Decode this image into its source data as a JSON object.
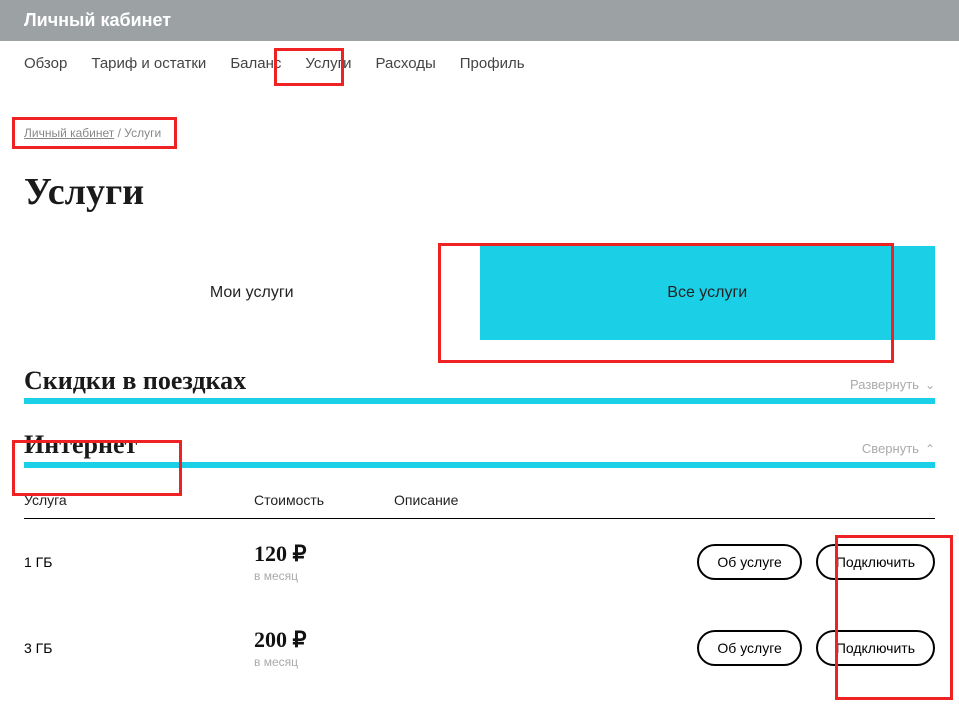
{
  "header": {
    "title": "Личный кабинет"
  },
  "nav": {
    "items": [
      "Обзор",
      "Тариф и остатки",
      "Баланс",
      "Услуги",
      "Расходы",
      "Профиль"
    ]
  },
  "breadcrumb": {
    "root": "Личный кабинет",
    "sep": " / ",
    "current": "Услуги"
  },
  "page": {
    "title": "Услуги"
  },
  "tabs": {
    "my": "Мои услуги",
    "all": "Все услуги"
  },
  "sections": {
    "discounts": {
      "title": "Скидки в поездках",
      "toggle": "Развернуть"
    },
    "internet": {
      "title": "Интернет",
      "toggle": "Свернуть"
    }
  },
  "table": {
    "headers": {
      "name": "Услуга",
      "price": "Стоимость",
      "desc": "Описание"
    },
    "period": "в месяц",
    "currency": "₽",
    "about_btn": "Об услуге",
    "connect_btn": "Подключить",
    "rows": [
      {
        "name": "1 ГБ",
        "price": "120"
      },
      {
        "name": "3 ГБ",
        "price": "200"
      }
    ]
  }
}
